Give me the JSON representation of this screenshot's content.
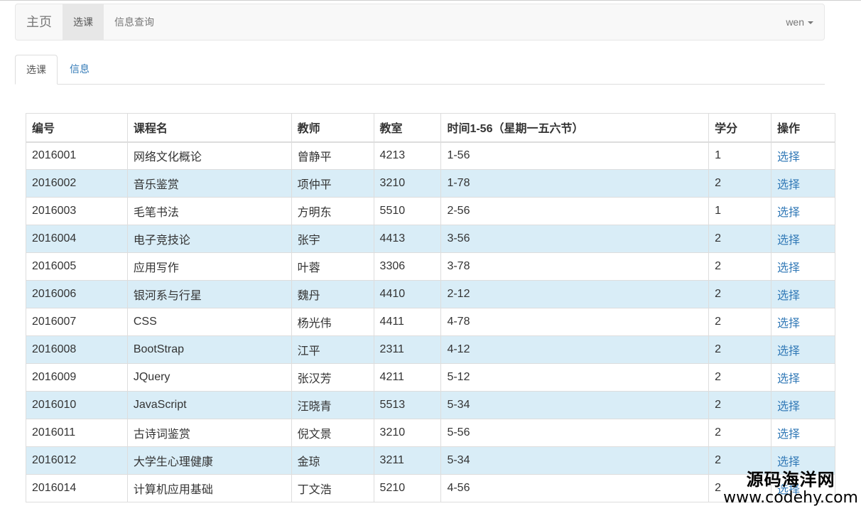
{
  "navbar": {
    "brand": "主页",
    "items": [
      {
        "label": "选课",
        "active": true
      },
      {
        "label": "信息查询",
        "active": false
      }
    ],
    "user": "wen"
  },
  "tabs": [
    {
      "label": "选课",
      "active": true
    },
    {
      "label": "信息",
      "active": false
    }
  ],
  "table": {
    "headers": [
      "编号",
      "课程名",
      "教师",
      "教室",
      "时间1-56（星期一五六节）",
      "学分",
      "操作"
    ],
    "rows": [
      [
        "2016001",
        "网络文化概论",
        "曾静平",
        "4213",
        "1-56",
        "1",
        "选择"
      ],
      [
        "2016002",
        "音乐鉴赏",
        "项仲平",
        "3210",
        "1-78",
        "2",
        "选择"
      ],
      [
        "2016003",
        "毛笔书法",
        "方明东",
        "5510",
        "2-56",
        "1",
        "选择"
      ],
      [
        "2016004",
        "电子竞技论",
        "张宇",
        "4413",
        "3-56",
        "2",
        "选择"
      ],
      [
        "2016005",
        "应用写作",
        "叶蓉",
        "3306",
        "3-78",
        "2",
        "选择"
      ],
      [
        "2016006",
        "银河系与行星",
        "魏丹",
        "4410",
        "2-12",
        "2",
        "选择"
      ],
      [
        "2016007",
        "CSS",
        "杨光伟",
        "4411",
        "4-78",
        "2",
        "选择"
      ],
      [
        "2016008",
        "BootStrap",
        "江平",
        "2311",
        "4-12",
        "2",
        "选择"
      ],
      [
        "2016009",
        "JQuery",
        "张汉芳",
        "4211",
        "5-12",
        "2",
        "选择"
      ],
      [
        "2016010",
        "JavaScript",
        "汪晓青",
        "5513",
        "5-34",
        "2",
        "选择"
      ],
      [
        "2016011",
        "古诗词鉴赏",
        "倪文景",
        "3210",
        "5-56",
        "2",
        "选择"
      ],
      [
        "2016012",
        "大学生心理健康",
        "金琼",
        "3211",
        "5-34",
        "2",
        "选择"
      ],
      [
        "2016014",
        "计算机应用基础",
        "丁文浩",
        "5210",
        "4-56",
        "2",
        "选择"
      ]
    ]
  },
  "watermark": {
    "line1": "源码海洋网",
    "line2": "www.codehy.com"
  },
  "colors": {
    "link": "#337ab7",
    "row_stripe": "#d9edf7",
    "navbar_bg": "#f8f8f8"
  }
}
